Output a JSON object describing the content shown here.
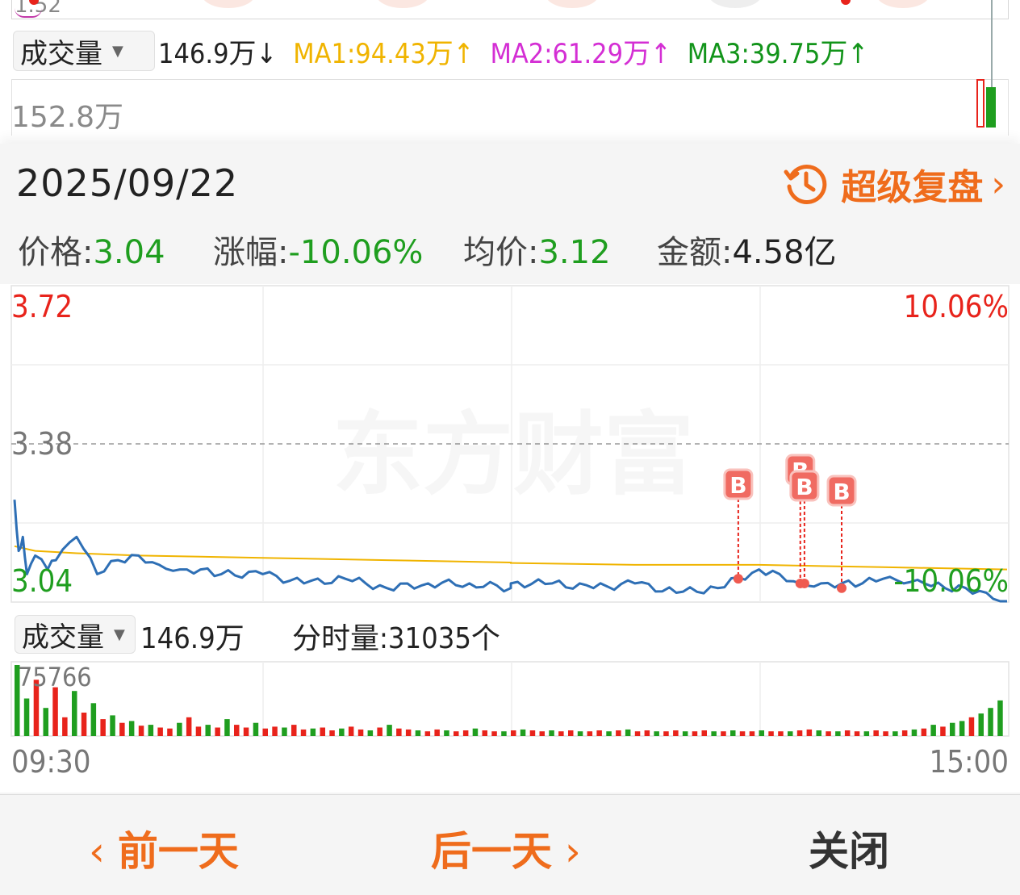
{
  "top_panel": {
    "cut_label": "1.52",
    "volume_selector": "成交量",
    "volume_value": "146.9万↓",
    "ma1": "MA1:94.43万↑",
    "ma2": "MA2:61.29万↑",
    "ma3": "MA3:39.75万↑",
    "volume_max_label": "152.8万"
  },
  "popup": {
    "date": "2025/09/22",
    "replay_label": "超级复盘",
    "stats": {
      "price_key": "价格:",
      "price_value": "3.04",
      "change_key": "涨幅:",
      "change_value": "-10.06%",
      "avg_key": "均价:",
      "avg_value": "3.12",
      "amount_key": "金额:",
      "amount_value": "4.58亿"
    },
    "watermark": "东方财富",
    "volume_selector": "成交量",
    "volume_total": "146.9万",
    "minute_volume": "分时量:31035个",
    "buttons": {
      "prev_day": "前一天",
      "next_day": "后一天",
      "close": "关闭"
    },
    "colors": {
      "accent": "#ef6c1c",
      "up": "#e8231b",
      "down": "#1f9e1f",
      "price_line": "#2e6fb5",
      "avg_line": "#f0b400"
    }
  },
  "chart_data": {
    "type": "line",
    "title": "",
    "x_range": [
      "09:30",
      "15:00"
    ],
    "xlabel": "",
    "ylabel": "",
    "ylim": [
      3.04,
      3.72
    ],
    "y_ticks_left": [
      "3.72",
      "3.38",
      "3.04"
    ],
    "y_ticks_right": [
      "10.06%",
      "-10.06%"
    ],
    "reference_price": 3.38,
    "grid": true,
    "series": [
      {
        "role": "price",
        "x": [
          "09:30",
          "09:31",
          "09:32",
          "09:33",
          "09:35",
          "09:38",
          "09:40",
          "09:45",
          "09:50",
          "09:55",
          "10:00",
          "10:05",
          "10:10",
          "10:15",
          "10:20",
          "10:30",
          "10:40",
          "10:50",
          "11:00",
          "11:10",
          "11:20",
          "11:30",
          "13:00",
          "13:10",
          "13:20",
          "13:30",
          "13:40",
          "13:50",
          "14:00",
          "14:05",
          "14:10",
          "14:15",
          "14:20",
          "14:25",
          "14:30",
          "14:35",
          "14:40",
          "14:45",
          "14:50",
          "14:55",
          "15:00"
        ],
        "values": [
          3.26,
          3.15,
          3.18,
          3.1,
          3.14,
          3.11,
          3.13,
          3.18,
          3.1,
          3.13,
          3.14,
          3.12,
          3.11,
          3.11,
          3.1,
          3.1,
          3.08,
          3.09,
          3.07,
          3.08,
          3.08,
          3.07,
          3.08,
          3.08,
          3.07,
          3.08,
          3.06,
          3.07,
          3.11,
          3.1,
          3.08,
          3.08,
          3.08,
          3.08,
          3.09,
          3.08,
          3.08,
          3.07,
          3.07,
          3.06,
          3.04
        ]
      },
      {
        "role": "average",
        "x": [
          "09:30",
          "09:35",
          "09:45",
          "10:00",
          "10:30",
          "11:00",
          "11:30",
          "13:00",
          "13:30",
          "14:00",
          "14:30",
          "15:00"
        ],
        "values": [
          3.16,
          3.15,
          3.145,
          3.14,
          3.135,
          3.13,
          3.125,
          3.124,
          3.12,
          3.12,
          3.115,
          3.11
        ]
      }
    ],
    "buy_markers": [
      {
        "label": "B",
        "time": "13:55",
        "price": 3.09
      },
      {
        "label": "B",
        "time": "14:10",
        "price": 3.08
      },
      {
        "label": "B",
        "time": "14:11",
        "price": 3.08
      },
      {
        "label": "B",
        "time": "14:20",
        "price": 3.07
      }
    ],
    "volume": {
      "max_label": "75766",
      "max": 75766,
      "values": [
        75766,
        40000,
        60000,
        30000,
        52000,
        20000,
        48000,
        25000,
        35000,
        18000,
        22000,
        14000,
        16000,
        11000,
        12000,
        9000,
        8000,
        14000,
        20000,
        10000,
        12000,
        9000,
        18000,
        12000,
        9000,
        14000,
        8000,
        10000,
        9000,
        12000,
        7000,
        8000,
        9000,
        6000,
        8000,
        10000,
        7000,
        6000,
        9000,
        12000,
        8000,
        7000,
        6000,
        5000,
        7000,
        6000,
        5000,
        6000,
        8000,
        6000,
        5000,
        5000,
        6000,
        7000,
        6000,
        5000,
        6000,
        5000,
        6000,
        5000,
        5000,
        6000,
        5000,
        6000,
        7000,
        5000,
        6000,
        5000,
        5000,
        6000,
        5000,
        5000,
        6000,
        5000,
        5000,
        6000,
        5000,
        5000,
        6000,
        5000,
        5000,
        5000,
        6000,
        7000,
        6000,
        5000,
        5000,
        6000,
        5000,
        5000,
        6000,
        5000,
        5000,
        6000,
        7000,
        8000,
        12000,
        10000,
        14000,
        16000,
        20000,
        24000,
        30000,
        38000
      ],
      "colors": [
        "g",
        "g",
        "r",
        "g",
        "r",
        "r",
        "g",
        "r",
        "g",
        "r",
        "g",
        "r",
        "g",
        "r",
        "g",
        "r",
        "r",
        "g",
        "r",
        "r",
        "g",
        "r",
        "g",
        "r",
        "r",
        "g",
        "r",
        "r",
        "g",
        "r",
        "r",
        "g",
        "r",
        "r",
        "g",
        "r",
        "r",
        "g",
        "r",
        "g",
        "r",
        "r",
        "g",
        "r",
        "r",
        "g",
        "r",
        "r",
        "g",
        "r",
        "r",
        "g",
        "r",
        "g",
        "r",
        "r",
        "g",
        "r",
        "r",
        "g",
        "r",
        "r",
        "g",
        "r",
        "g",
        "r",
        "r",
        "g",
        "r",
        "r",
        "g",
        "r",
        "r",
        "g",
        "r",
        "g",
        "r",
        "r",
        "g",
        "r",
        "r",
        "g",
        "r",
        "r",
        "g",
        "r",
        "g",
        "r",
        "r",
        "g",
        "r",
        "r",
        "g",
        "r",
        "g",
        "r",
        "g",
        "r",
        "g",
        "g",
        "r",
        "g",
        "g",
        "g"
      ]
    }
  }
}
